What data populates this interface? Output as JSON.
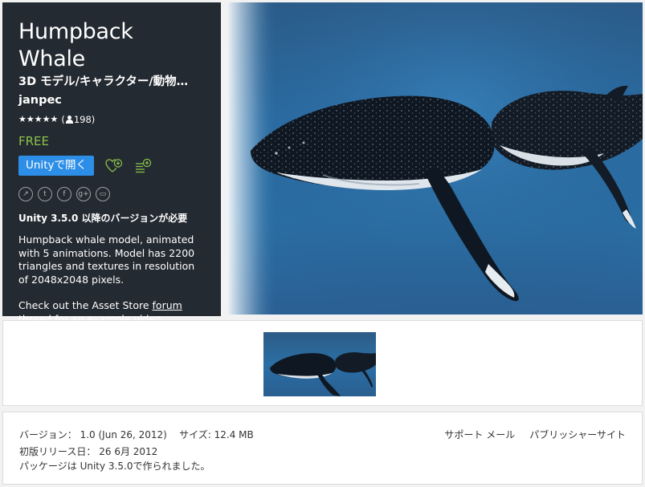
{
  "asset": {
    "title": "Humpback Whale",
    "category": "3D モデル/キャラクター/動物…",
    "publisher": "janpec",
    "stars": "★★★★★",
    "rating_open": "(",
    "rating_count": "198)",
    "rating_value_of_5": 5,
    "price": "FREE"
  },
  "actions": {
    "open_label": "Unityで開く",
    "wishlist_icon": "heart-plus-icon",
    "add_to_list_icon": "list-plus-icon"
  },
  "share": [
    "link-icon",
    "twitter-icon",
    "facebook-icon",
    "google-plus-icon",
    "comment-icon"
  ],
  "share_glyphs": [
    "↗",
    "t",
    "f",
    "g+",
    "▭"
  ],
  "requirement": "Unity 3.5.0 以降のバージョンが必要",
  "description": {
    "para1": "Humpback whale model, animated with 5 animations. Model has 2200 triangles and textures in resolution of 2048x2048 pixels.",
    "para2_prefix": "Check out the Asset Store ",
    "para2_link1": "forum",
    "para2_link2": "thread",
    "para2_suffix": " for an example video."
  },
  "details": {
    "version_label": "バージョン：",
    "version_value": "1.0 (Jun 26, 2012)",
    "size_label": "サイズ:",
    "size_value": "12.4 MB",
    "release_label": "初版リリース日：",
    "release_value": "26 6月 2012",
    "package_note": "パッケージは Unity 3.5.0で作られました。"
  },
  "support": {
    "support_mail": "サポート メール",
    "publisher_site": "パブリッシャーサイト"
  },
  "colors": {
    "panel_bg": "#242a31",
    "accent_blue": "#2d8ee8",
    "free_green": "#8bc34a",
    "water_blue": "#2a6ea6"
  }
}
